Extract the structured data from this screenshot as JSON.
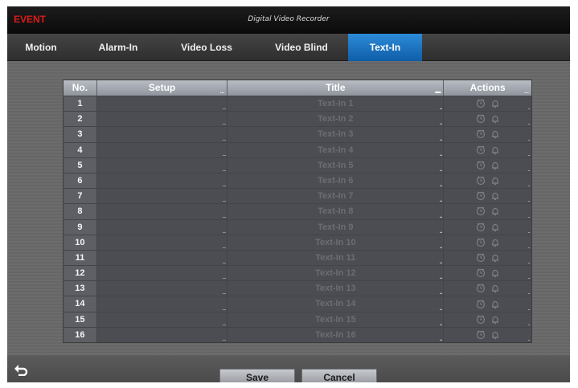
{
  "titlebar": {
    "section": "EVENT",
    "app_title": "Digital Video Recorder"
  },
  "tabs": [
    {
      "label": "Motion",
      "active": false
    },
    {
      "label": "Alarm-In",
      "active": false
    },
    {
      "label": "Video Loss",
      "active": false
    },
    {
      "label": "Video Blind",
      "active": false
    },
    {
      "label": "Text-In",
      "active": true
    }
  ],
  "table": {
    "headers": {
      "no": "No.",
      "setup": "Setup",
      "title": "Title",
      "actions": "Actions"
    },
    "rows": [
      {
        "no": "1",
        "title": "Text-In 1"
      },
      {
        "no": "2",
        "title": "Text-In 2"
      },
      {
        "no": "3",
        "title": "Text-In 3"
      },
      {
        "no": "4",
        "title": "Text-In 4"
      },
      {
        "no": "5",
        "title": "Text-In 5"
      },
      {
        "no": "6",
        "title": "Text-In 6"
      },
      {
        "no": "7",
        "title": "Text-In 7"
      },
      {
        "no": "8",
        "title": "Text-In 8"
      },
      {
        "no": "9",
        "title": "Text-In 9"
      },
      {
        "no": "10",
        "title": "Text-In 10"
      },
      {
        "no": "11",
        "title": "Text-In 11"
      },
      {
        "no": "12",
        "title": "Text-In 12"
      },
      {
        "no": "13",
        "title": "Text-In 13"
      },
      {
        "no": "14",
        "title": "Text-In 14"
      },
      {
        "no": "15",
        "title": "Text-In 15"
      },
      {
        "no": "16",
        "title": "Text-In 16"
      }
    ]
  },
  "footer": {
    "save_label": "Save",
    "cancel_label": "Cancel",
    "back_icon": "back-arrow-icon"
  },
  "colors": {
    "event_red": "#e01a1a",
    "active_tab": "#1a6fc0"
  }
}
